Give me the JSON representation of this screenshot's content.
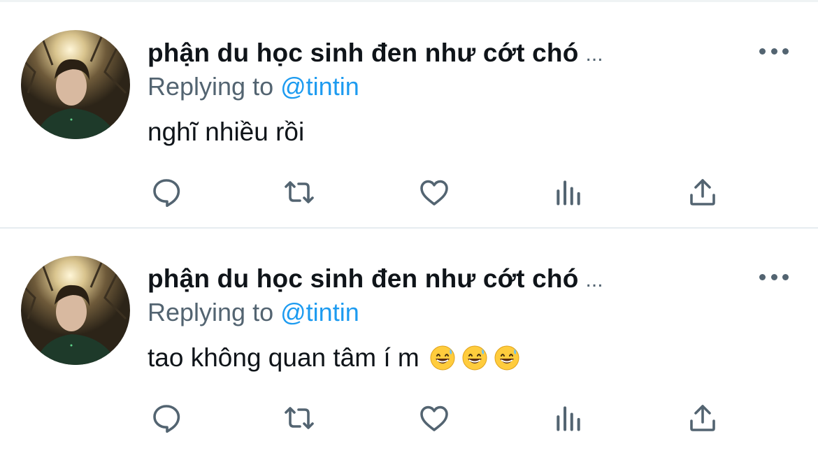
{
  "colors": {
    "text_primary": "#0f1419",
    "text_secondary": "#536471",
    "accent": "#1d9bf0",
    "divider": "#e6ecf0"
  },
  "tweets": [
    {
      "author_name": "phận du học sinh đen như cớt chó",
      "name_truncation": "...",
      "reply_prefix": "Replying to",
      "reply_handle": "@tintin",
      "text": "nghĩ nhiều rồi",
      "emojis": [],
      "actions": [
        "reply-icon",
        "retweet-icon",
        "like-icon",
        "views-icon",
        "share-icon"
      ],
      "more_icon": "more-options-icon"
    },
    {
      "author_name": "phận du học sinh đen như cớt chó",
      "name_truncation": "...",
      "reply_prefix": "Replying to",
      "reply_handle": "@tintin",
      "text": "tao không quan tâm í m",
      "emojis": [
        "grinning-face-with-sweat",
        "grinning-face-with-sweat",
        "grinning-face-with-sweat"
      ],
      "actions": [
        "reply-icon",
        "retweet-icon",
        "like-icon",
        "views-icon",
        "share-icon"
      ],
      "more_icon": "more-options-icon"
    }
  ]
}
